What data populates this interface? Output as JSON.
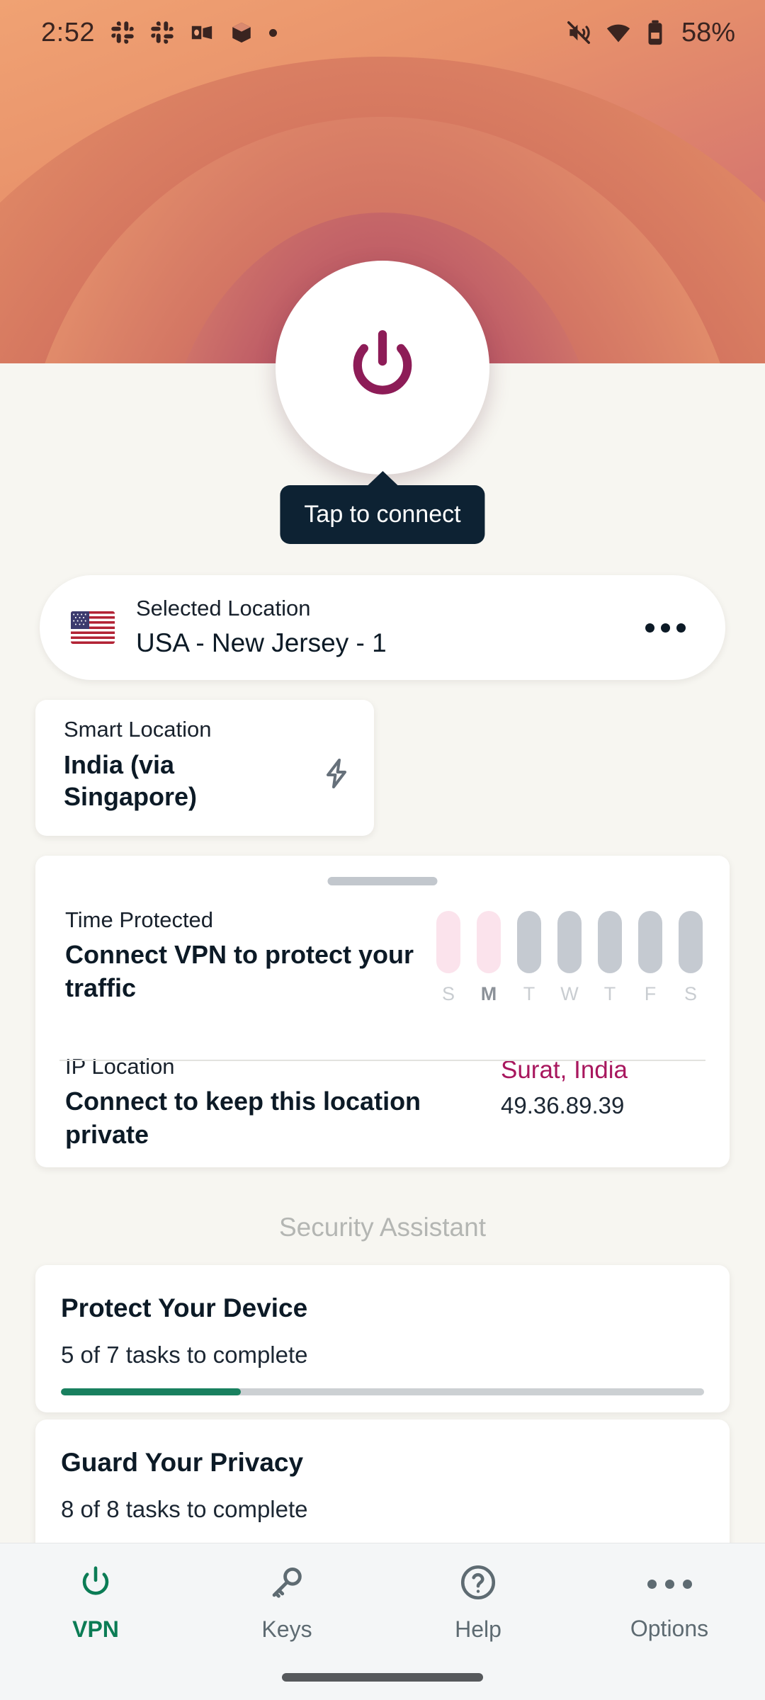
{
  "status_bar": {
    "time": "2:52",
    "icons": [
      "slack-icon",
      "slack-icon",
      "outlook-icon",
      "package-icon",
      "dot-indicator"
    ],
    "right_icons": [
      "mute-icon",
      "wifi-icon",
      "battery-icon"
    ],
    "battery_percent": "58%"
  },
  "hero": {
    "power_button_icon": "power-icon",
    "power_icon_color": "#8D1C57",
    "tooltip": "Tap to connect",
    "tooltip_bg": "#0D2233",
    "gradient_outer": "#EC9D6C",
    "gradient_inner": "#8E1F50"
  },
  "selected_location": {
    "flag": "us-flag-icon",
    "label": "Selected Location",
    "value": "USA - New Jersey - 1",
    "menu_icon": "kebab-menu-icon"
  },
  "smart_location": {
    "label": "Smart Location",
    "value": "India (via Singapore)",
    "icon": "lightning-bolt-icon"
  },
  "stats": {
    "time_protected": {
      "label": "Time Protected",
      "message": "Connect VPN to protect your traffic"
    },
    "ip_location": {
      "label": "IP Location",
      "message": "Connect to keep this location private",
      "city": "Surat, India",
      "city_color": "#A8175E",
      "ip_address": "49.36.89.39"
    }
  },
  "chart_data": {
    "type": "bar",
    "title": "Time Protected",
    "categories": [
      "S",
      "M",
      "T",
      "W",
      "T",
      "F",
      "S"
    ],
    "values": [
      0,
      0,
      0,
      0,
      0,
      0,
      0
    ],
    "bar_colors": [
      "#FBE3EC",
      "#FBE3EC",
      "#C5CAD1",
      "#C5CAD1",
      "#C5CAD1",
      "#C5CAD1",
      "#C5CAD1"
    ],
    "label_colors": [
      "#C9CDD1",
      "#8C9299",
      "#C9CDD1",
      "#C9CDD1",
      "#C9CDD1",
      "#C9CDD1",
      "#C9CDD1"
    ],
    "xlabel": "",
    "ylabel": "",
    "grid": false,
    "legend": false
  },
  "security_assistant": {
    "title": "Security Assistant",
    "tasks": [
      {
        "title": "Protect Your Device",
        "subtitle": "5 of 7 tasks to complete",
        "progress_percent": 28,
        "progress_color": "#19805F"
      },
      {
        "title": "Guard Your Privacy",
        "subtitle": "8 of 8 tasks to complete",
        "progress_percent": 0,
        "progress_color": "#19805F"
      }
    ]
  },
  "bottom_nav": {
    "items": [
      {
        "label": "VPN",
        "icon": "power-icon",
        "active": true
      },
      {
        "label": "Keys",
        "icon": "key-icon",
        "active": false
      },
      {
        "label": "Help",
        "icon": "question-circle-icon",
        "active": false
      },
      {
        "label": "Options",
        "icon": "kebab-menu-icon",
        "active": false
      }
    ],
    "active_color": "#0B7C55",
    "inactive_color": "#5E6B72"
  }
}
